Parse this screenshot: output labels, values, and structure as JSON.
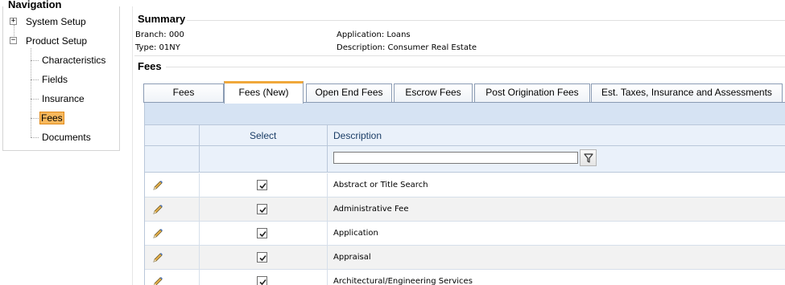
{
  "navigation": {
    "title": "Navigation",
    "items": [
      {
        "label": "System Setup",
        "expander": "+"
      },
      {
        "label": "Product Setup",
        "expander": "−"
      },
      {
        "label": "Characteristics"
      },
      {
        "label": "Fields"
      },
      {
        "label": "Insurance"
      },
      {
        "label": "Fees",
        "selected": true
      },
      {
        "label": "Documents"
      }
    ]
  },
  "summary": {
    "title": "Summary",
    "branch": "Branch: 000",
    "type": "Type: 01NY",
    "application": "Application: Loans",
    "description": "Description: Consumer Real Estate"
  },
  "fees": {
    "title": "Fees",
    "tabs": [
      {
        "label": "Fees"
      },
      {
        "label": "Fees (New)",
        "active": true
      },
      {
        "label": "Open End Fees"
      },
      {
        "label": "Escrow Fees"
      },
      {
        "label": "Post Origination Fees"
      },
      {
        "label": "Est. Taxes, Insurance and Assessments"
      }
    ],
    "grid": {
      "columns": {
        "select": "Select",
        "description": "Description"
      },
      "filter": {
        "value": "",
        "placeholder": "",
        "icon": "filter-icon"
      },
      "rows": [
        {
          "checked": true,
          "description": "Abstract or Title Search"
        },
        {
          "checked": true,
          "description": "Administrative Fee"
        },
        {
          "checked": true,
          "description": "Application"
        },
        {
          "checked": true,
          "description": "Appraisal"
        },
        {
          "checked": true,
          "description": "Architectural/Engineering Services"
        }
      ]
    }
  },
  "colors": {
    "accent_tab": "#f0a83a",
    "selected_node": "#f7b85c",
    "grid_header": "#eaf1fa",
    "grid_band": "#d6e3f3",
    "header_text": "#1a3d66"
  }
}
